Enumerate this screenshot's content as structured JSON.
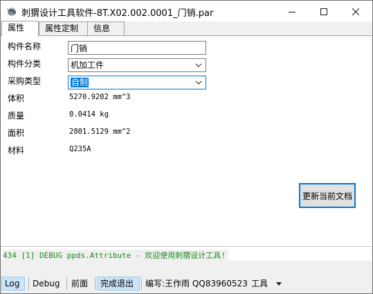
{
  "window": {
    "title": "刺猬设计工具软件-8T.X02.002.0001_门销.par",
    "icon": "hedgehog-app-icon"
  },
  "tabs": [
    {
      "label": "属性",
      "active": true
    },
    {
      "label": "属性定制",
      "active": false
    },
    {
      "label": "信息",
      "active": false
    }
  ],
  "properties": {
    "name_label": "构件名称",
    "name_value": "门销",
    "category_label": "构件分类",
    "category_value": "机加工件",
    "purchase_label": "采购类型",
    "purchase_value": "自制",
    "volume_label": "体积",
    "volume_value": "5270.9202 mm^3",
    "mass_label": "质量",
    "mass_value": "0.0414 kg",
    "area_label": "面积",
    "area_value": "2801.5129 mm^2",
    "material_label": "材料",
    "material_value": "Q235A"
  },
  "update_button": "更新当前文档",
  "log": {
    "line": "434 [1] DEBUG ppds.Attribute - 欢迎使用刺猬设计工具!",
    "color": "#1e8a1e"
  },
  "statusbar": {
    "log": "Log",
    "debug": "Debug",
    "front": "前面",
    "finish": "完成退出",
    "author": "编写:王作雨 QQ83960523",
    "tools": "工具"
  },
  "colors": {
    "accent": "#0078d7",
    "panel_bg": "#ffffff",
    "window_bg": "#f0f0f0"
  }
}
